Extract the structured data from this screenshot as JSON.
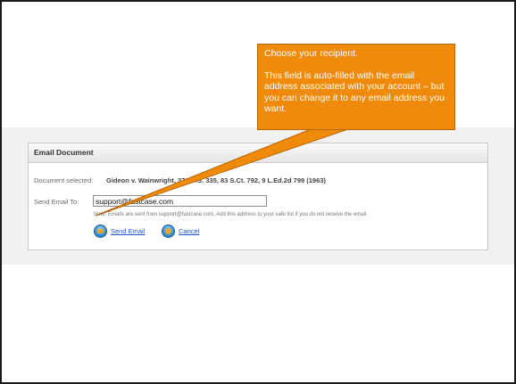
{
  "callout": {
    "title": "Choose your recipient.",
    "body": "This field is auto-filled with the email address associated with your account – but you can change it to any email address you want."
  },
  "panel": {
    "header": "Email Document",
    "document_label": "Document selected:",
    "document_value": "Gideon v. Wainwright, 372 U.S. 335, 83 S.Ct. 792, 9 L.Ed.2d 799 (1963)",
    "send_label": "Send Email To:",
    "email_value": "support@fastcase.com",
    "note": "Note: Emails are sent from support@fastcase.com. Add this address to your safe list if you do not receive the email.",
    "send_button": "Send Email",
    "cancel_button": "Cancel"
  },
  "icons": {
    "send": "send-email-icon",
    "cancel": "cancel-icon"
  },
  "colors": {
    "callout_fill": "#f08a0a",
    "link": "#1a58c8",
    "frame": "#1a1a1a"
  }
}
